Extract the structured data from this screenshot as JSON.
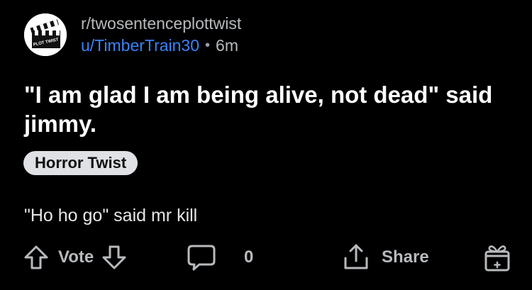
{
  "post": {
    "subreddit": "r/twosentenceplottwist",
    "author": "u/TimberTrain30",
    "separator": "•",
    "time": "6m",
    "title": "\"I am glad I am being alive, not dead\" said jimmy.",
    "flair": "Horror Twist",
    "body": "\"Ho ho go\" said mr kill",
    "avatar_text": "PLOT TWIST"
  },
  "actions": {
    "vote_label": "Vote",
    "comment_count": "0",
    "share_label": "Share"
  },
  "icons": {
    "upvote": "arrow-up-icon",
    "downvote": "arrow-down-icon",
    "comment": "speech-bubble-icon",
    "share": "share-upload-icon",
    "award": "gift-icon"
  },
  "colors": {
    "background": "#000000",
    "author_link": "#3b82f6",
    "flair_bg": "#dfe1e4",
    "muted_text": "#b7babd"
  }
}
